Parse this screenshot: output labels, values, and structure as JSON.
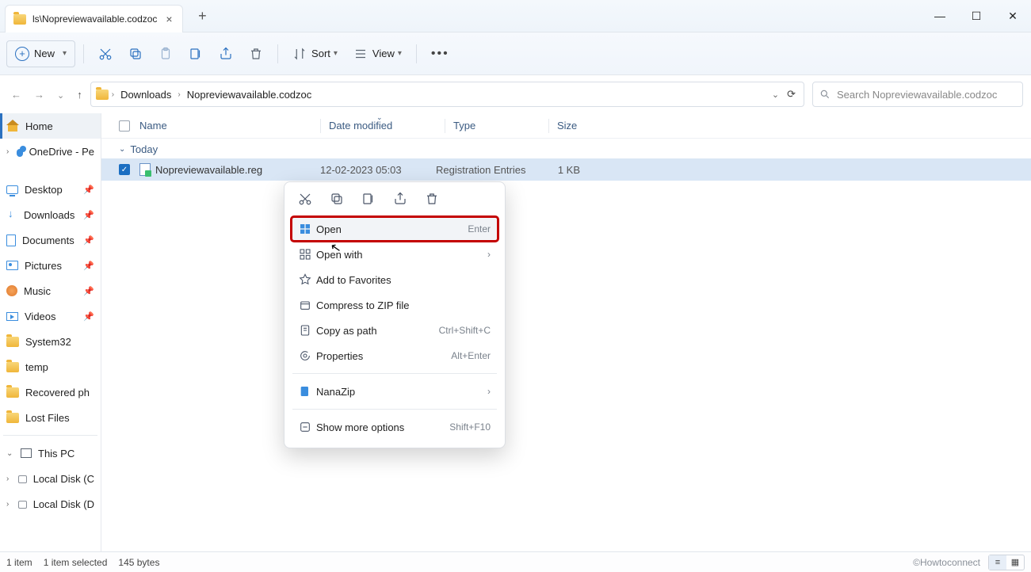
{
  "tab": {
    "title": "ls\\Nopreviewavailable.codzoc"
  },
  "toolbar": {
    "new": "New",
    "sort": "Sort",
    "view": "View"
  },
  "breadcrumb": {
    "items": [
      "Downloads",
      "Nopreviewavailable.codzoc"
    ]
  },
  "search": {
    "placeholder": "Search Nopreviewavailable.codzoc"
  },
  "columns": {
    "name": "Name",
    "date": "Date modified",
    "type": "Type",
    "size": "Size"
  },
  "group": {
    "today": "Today"
  },
  "file": {
    "name": "Nopreviewavailable.reg",
    "date": "12-02-2023 05:03",
    "type": "Registration Entries",
    "size": "1 KB"
  },
  "sidebar": {
    "home": "Home",
    "onedrive": "OneDrive - Pe",
    "quick": [
      "Desktop",
      "Downloads",
      "Documents",
      "Pictures",
      "Music",
      "Videos",
      "System32",
      "temp",
      "Recovered ph",
      "Lost Files"
    ],
    "thispc": "This PC",
    "drives": [
      "Local Disk (C",
      "Local Disk (D"
    ]
  },
  "context": {
    "open": "Open",
    "open_accel": "Enter",
    "openwith": "Open with",
    "fav": "Add to Favorites",
    "zip": "Compress to ZIP file",
    "copypath": "Copy as path",
    "copypath_accel": "Ctrl+Shift+C",
    "props": "Properties",
    "props_accel": "Alt+Enter",
    "nanazip": "NanaZip",
    "more": "Show more options",
    "more_accel": "Shift+F10"
  },
  "status": {
    "count": "1 item",
    "selected": "1 item selected",
    "bytes": "145 bytes"
  },
  "watermark": "©Howtoconnect"
}
